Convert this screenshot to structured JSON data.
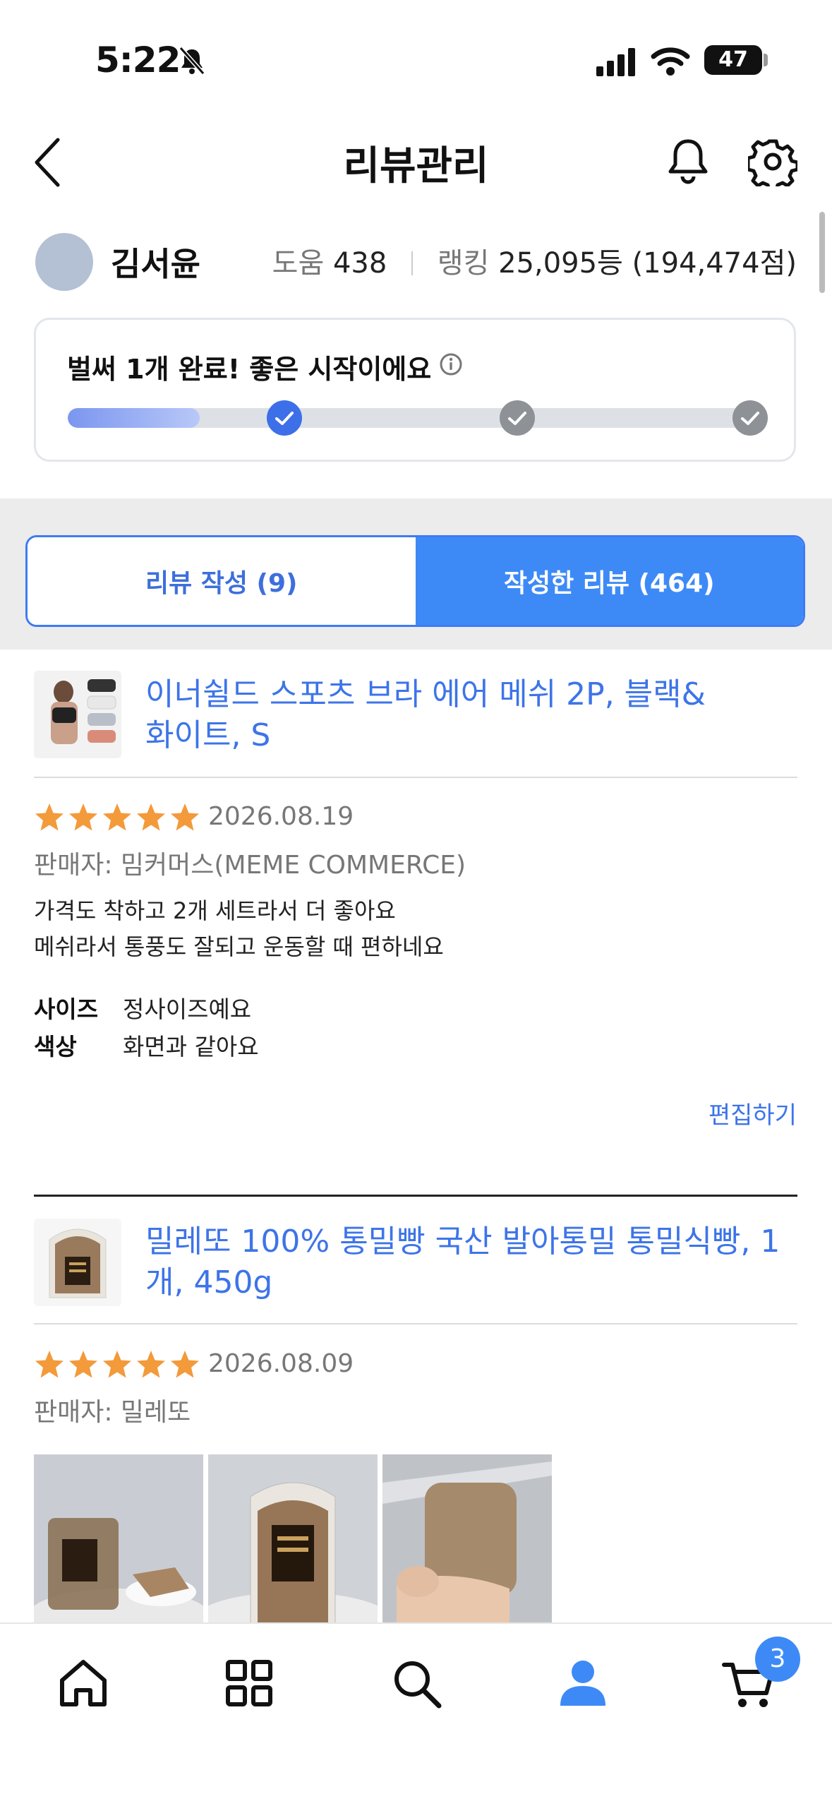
{
  "status_bar": {
    "time": "5:22",
    "battery": "47"
  },
  "header": {
    "title": "리뷰관리"
  },
  "profile": {
    "name": "김서윤",
    "help_label": "도움",
    "help_value": "438",
    "rank_label": "랭킹",
    "rank_value": "25,095등 (194,474점)"
  },
  "progress": {
    "message": "벌써 1개 완료! 좋은 시작이에요",
    "completed_steps": 1,
    "total_steps": 3,
    "fill_fraction": 0.19
  },
  "tabs": [
    {
      "label": "리뷰 작성 (9)",
      "active": false
    },
    {
      "label": "작성한 리뷰 (464)",
      "active": true
    }
  ],
  "reviews": [
    {
      "product": "이너쉴드 스포츠 브라 에어 메쉬 2P, 블랙&화이트, S",
      "product_line1": "이너쉴드 스포츠 브라 에어 메쉬 2P, 블랙&",
      "product_line2": "화이트, S",
      "rating": 5,
      "date": "2026.08.19",
      "seller": "판매자: 밈커머스(MEME COMMERCE)",
      "body_line1": "가격도 착하고 2개 세트라서 더 좋아요",
      "body_line2": "메쉬라서 통풍도 잘되고 운동할 때 편하네요",
      "attributes": [
        {
          "label": "사이즈",
          "value": "정사이즈예요"
        },
        {
          "label": "색상",
          "value": "화면과 같아요"
        }
      ],
      "edit_label": "편집하기"
    },
    {
      "product_line1": "밀레또 100% 통밀빵 국산 발아통밀 통밀식빵, 1",
      "product_line2": "개, 450g",
      "rating": 5,
      "date": "2026.08.09",
      "seller": "판매자: 밀레또",
      "photo_count": 3
    }
  ],
  "bottom_nav": {
    "items": [
      "home-icon",
      "category-grid-icon",
      "search-icon",
      "profile-icon",
      "cart-icon"
    ],
    "active": "profile-icon",
    "cart_badge": "3"
  },
  "colors": {
    "accent": "#3d8af7",
    "link": "#3d74e8",
    "star": "#f39a3b"
  }
}
